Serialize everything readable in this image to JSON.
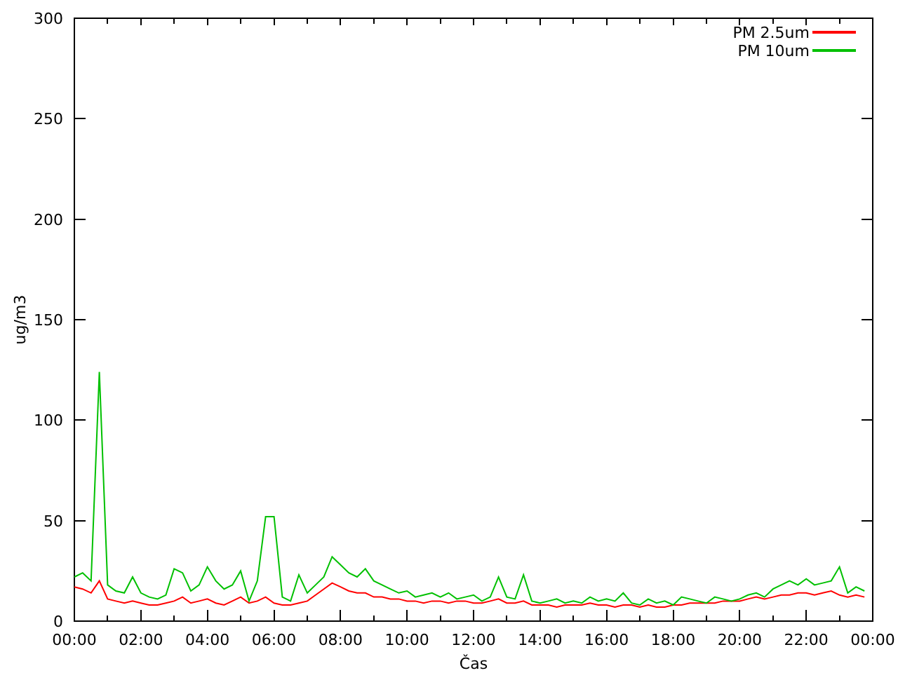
{
  "chart_data": {
    "type": "line",
    "xlabel": "Čas",
    "ylabel": "ug/m3",
    "xlim": [
      0,
      24
    ],
    "ylim": [
      0,
      300
    ],
    "xticks": [
      {
        "value": 0,
        "label": "00:00"
      },
      {
        "value": 2,
        "label": "02:00"
      },
      {
        "value": 4,
        "label": "04:00"
      },
      {
        "value": 6,
        "label": "06:00"
      },
      {
        "value": 8,
        "label": "08:00"
      },
      {
        "value": 10,
        "label": "10:00"
      },
      {
        "value": 12,
        "label": "12:00"
      },
      {
        "value": 14,
        "label": "14:00"
      },
      {
        "value": 16,
        "label": "16:00"
      },
      {
        "value": 18,
        "label": "18:00"
      },
      {
        "value": 20,
        "label": "20:00"
      },
      {
        "value": 22,
        "label": "22:00"
      },
      {
        "value": 24,
        "label": "00:00"
      }
    ],
    "yticks": [
      0,
      50,
      100,
      150,
      200,
      250,
      300
    ],
    "legend": "upper right",
    "x": [
      0,
      0.25,
      0.5,
      0.75,
      1,
      1.25,
      1.5,
      1.75,
      2,
      2.25,
      2.5,
      2.75,
      3,
      3.25,
      3.5,
      3.75,
      4,
      4.25,
      4.5,
      4.75,
      5,
      5.25,
      5.5,
      5.75,
      6,
      6.25,
      6.5,
      6.75,
      7,
      7.25,
      7.5,
      7.75,
      8,
      8.25,
      8.5,
      8.75,
      9,
      9.25,
      9.5,
      9.75,
      10,
      10.25,
      10.5,
      10.75,
      11,
      11.25,
      11.5,
      11.75,
      12,
      12.25,
      12.5,
      12.75,
      13,
      13.25,
      13.5,
      13.75,
      14,
      14.25,
      14.5,
      14.75,
      15,
      15.25,
      15.5,
      15.75,
      16,
      16.25,
      16.5,
      16.75,
      17,
      17.25,
      17.5,
      17.75,
      18,
      18.25,
      18.5,
      18.75,
      19,
      19.25,
      19.5,
      19.75,
      20,
      20.25,
      20.5,
      20.75,
      21,
      21.25,
      21.5,
      21.75,
      22,
      22.25,
      22.5,
      22.75,
      23,
      23.25,
      23.5,
      23.75
    ],
    "series": [
      {
        "name": "PM 2.5um",
        "color": "#ff0000",
        "values": [
          17,
          16,
          14,
          20,
          11,
          10,
          9,
          10,
          9,
          8,
          8,
          9,
          10,
          12,
          9,
          10,
          11,
          9,
          8,
          10,
          12,
          9,
          10,
          12,
          9,
          8,
          8,
          9,
          10,
          13,
          16,
          19,
          17,
          15,
          14,
          14,
          12,
          12,
          11,
          11,
          10,
          10,
          9,
          10,
          10,
          9,
          10,
          10,
          9,
          9,
          10,
          11,
          9,
          9,
          10,
          8,
          8,
          8,
          7,
          8,
          8,
          8,
          9,
          8,
          8,
          7,
          8,
          8,
          7,
          8,
          7,
          7,
          8,
          8,
          9,
          9,
          9,
          9,
          10,
          10,
          10,
          11,
          12,
          11,
          12,
          13,
          13,
          14,
          14,
          13,
          14,
          15,
          13,
          12,
          13,
          12
        ]
      },
      {
        "name": "PM 10um",
        "color": "#00c000",
        "values": [
          22,
          24,
          20,
          124,
          18,
          15,
          14,
          22,
          14,
          12,
          11,
          13,
          26,
          24,
          15,
          18,
          27,
          20,
          16,
          18,
          25,
          10,
          20,
          52,
          52,
          12,
          10,
          23,
          14,
          18,
          22,
          32,
          28,
          24,
          22,
          26,
          20,
          18,
          16,
          14,
          15,
          12,
          13,
          14,
          12,
          14,
          11,
          12,
          13,
          10,
          12,
          22,
          12,
          11,
          23,
          10,
          9,
          10,
          11,
          9,
          10,
          9,
          12,
          10,
          11,
          10,
          14,
          9,
          8,
          11,
          9,
          10,
          8,
          12,
          11,
          10,
          9,
          12,
          11,
          10,
          11,
          13,
          14,
          12,
          16,
          18,
          20,
          18,
          21,
          18,
          19,
          20,
          27,
          14,
          17,
          15
        ]
      }
    ]
  }
}
